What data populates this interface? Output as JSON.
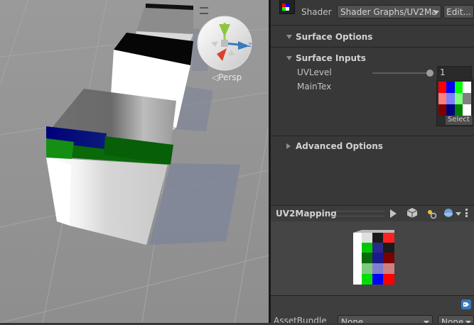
{
  "inspector": {
    "shader_label": "Shader",
    "shader_value": "Shader Graphs/UV2Ma",
    "edit_label": "Edit...",
    "surface_options": "Surface Options",
    "surface_inputs": "Surface Inputs",
    "uvlevel_label": "UVLevel",
    "uvlevel_value": "1",
    "uvlevel_slider_fraction": 1.0,
    "maintex_label": "MainTex",
    "select_label": "Select",
    "advanced_options": "Advanced Options"
  },
  "preview": {
    "title": "UV2Mapping"
  },
  "footer": {
    "asset_bundle_label": "AssetBundle",
    "asset_bundle_value": "None",
    "variant_value": "None"
  },
  "scene": {
    "camera_label": "◁Persp",
    "gizmo_axis_z": "z"
  },
  "colors": {
    "panel_bg": "#383838",
    "accent_blue": "#3a79bb"
  }
}
